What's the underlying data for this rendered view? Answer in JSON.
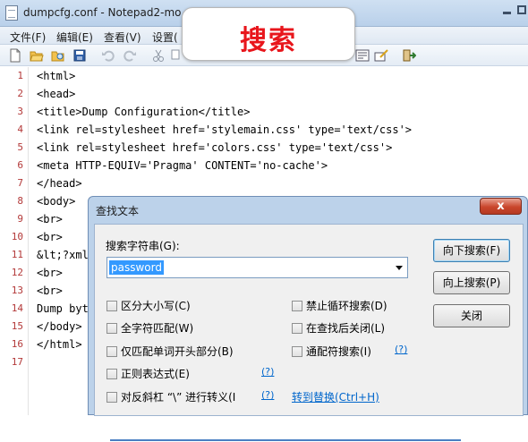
{
  "window": {
    "title": "dumpcfg.conf - Notepad2-mo"
  },
  "menu": [
    "文件(F)",
    "编辑(E)",
    "查看(V)",
    "设置("
  ],
  "toolbar_icons": [
    "new-file-icon",
    "open-folder-icon",
    "browse-icon",
    "save-icon",
    "undo-icon",
    "redo-icon",
    "cut-icon",
    "copy-icon",
    "wordwrap-icon",
    "customize-icon",
    "exit-icon"
  ],
  "callout": {
    "text": "搜索",
    "color": "#e8161c"
  },
  "editor": {
    "lines": [
      {
        "n": "1",
        "code": "<html>"
      },
      {
        "n": "2",
        "code": "<head>"
      },
      {
        "n": "3",
        "code": "<title>Dump Configuration</title>"
      },
      {
        "n": "4",
        "code": "<link rel=stylesheet href='stylemain.css' type='text/css'>"
      },
      {
        "n": "5",
        "code": "<link rel=stylesheet href='colors.css' type='text/css'>"
      },
      {
        "n": "6",
        "code": "<meta HTTP-EQUIV='Pragma' CONTENT='no-cache'>"
      },
      {
        "n": "7",
        "code": "</head>"
      },
      {
        "n": "8",
        "code": "<body>"
      },
      {
        "n": "9",
        "code": "<br>"
      },
      {
        "n": "10",
        "code": "<br>"
      },
      {
        "n": "11",
        "code": "&lt;?xml"
      },
      {
        "n": "12",
        "code": "<br>"
      },
      {
        "n": "13",
        "code": "<br>"
      },
      {
        "n": "14",
        "code": "Dump byt"
      },
      {
        "n": "15",
        "code": "</body>"
      },
      {
        "n": "16",
        "code": "</html>"
      },
      {
        "n": "17",
        "code": ""
      }
    ]
  },
  "dialog": {
    "title": "查找文本",
    "close": "x",
    "search_label": "搜索字符串(G):",
    "search_value": "password",
    "buttons": {
      "find_next": "向下搜索(F)",
      "find_prev": "向上搜索(P)",
      "close": "关闭"
    },
    "options": {
      "match_case": "区分大小写(C)",
      "whole_word": "全字符匹配(W)",
      "word_start": "仅匹配单词开头部分(B)",
      "regex": "正则表达式(E)",
      "backslash": "对反斜杠 “\\” 进行转义(I",
      "no_wrap": "禁止循环搜索(D)",
      "close_after": "在查找后关闭(L)",
      "wildcard": "通配符搜索(I)"
    },
    "help": "(?)",
    "replace_link": "转到替换(Ctrl+H)"
  }
}
